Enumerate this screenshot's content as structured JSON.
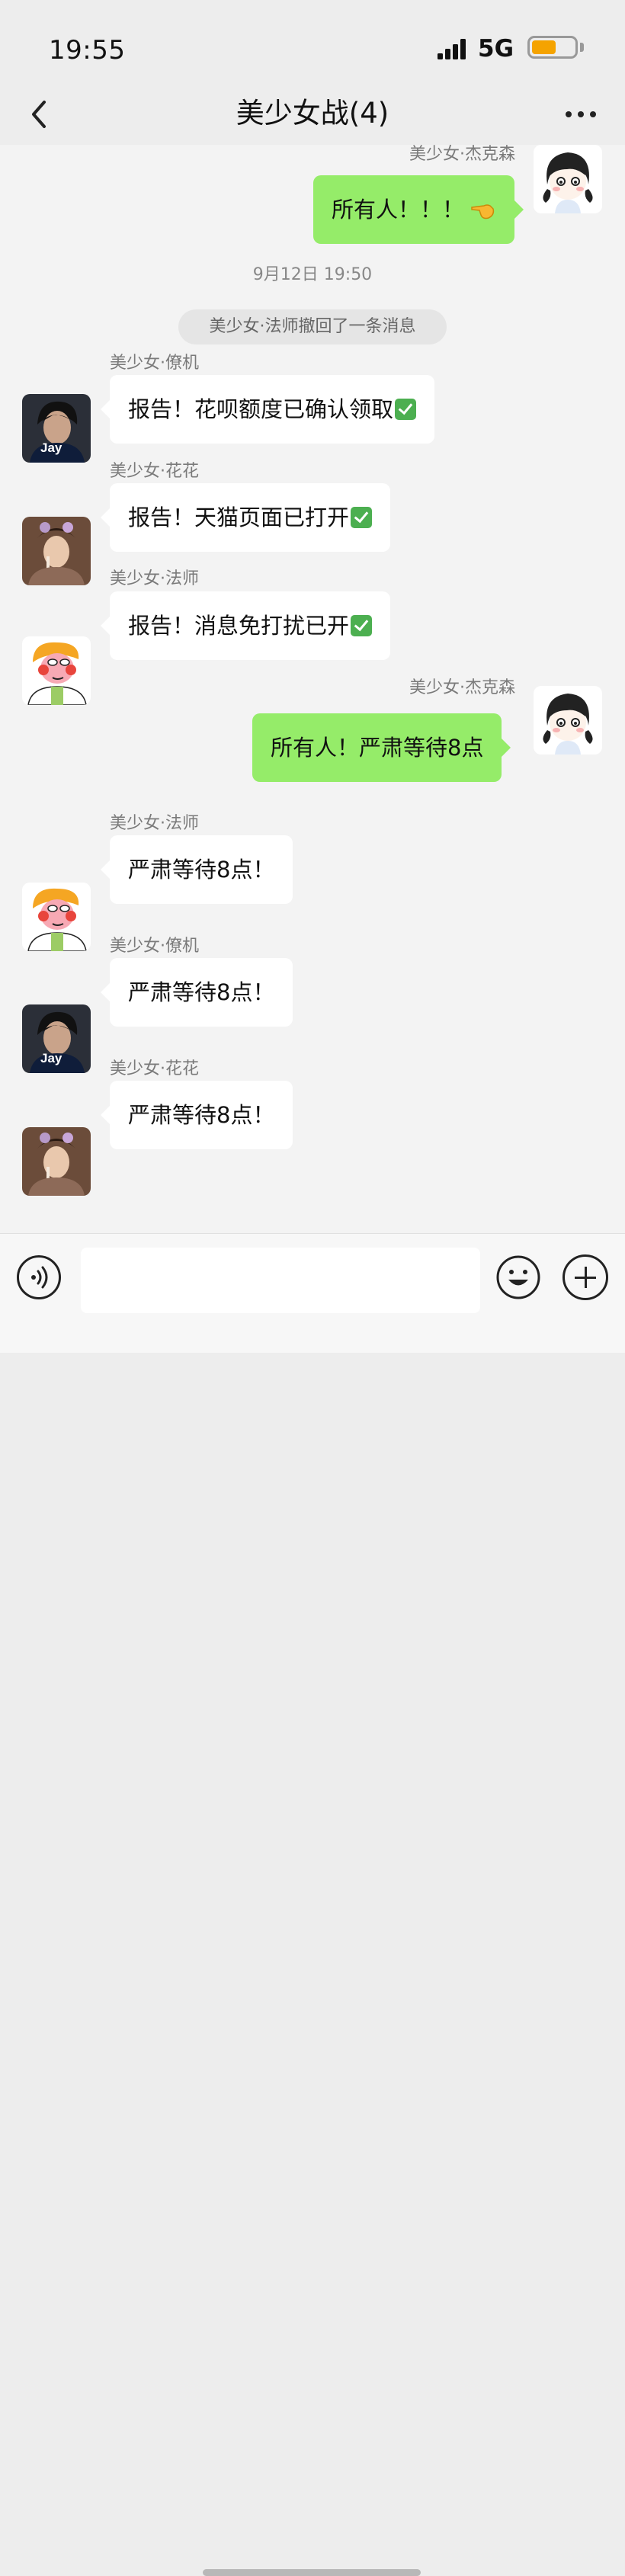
{
  "status_bar": {
    "time": "19:55",
    "network": "5G",
    "battery_level": 0.58,
    "battery_color": "#f5a300"
  },
  "header": {
    "title": "美少女战(4)",
    "back_icon": "chevron-left-icon",
    "more_icon": "more-dots-icon"
  },
  "colors": {
    "bubble_out": "#95ec69",
    "bubble_in": "#ffffff",
    "background": "#f3f3f3"
  },
  "messages": [
    {
      "sender": "美少女·杰克森",
      "text": "所有人！！！",
      "direction": "outgoing",
      "trailing_icon": "pointing-hand-emoji"
    },
    {
      "sender": "美少女·僚机",
      "text": "报告！花呗额度已确认领取",
      "direction": "incoming",
      "trailing_icon": "check-mark-emoji"
    },
    {
      "sender": "美少女·花花",
      "text": "报告！天猫页面已打开",
      "direction": "incoming",
      "trailing_icon": "check-mark-emoji"
    },
    {
      "sender": "美少女·法师",
      "text": "报告！消息免打扰已开",
      "direction": "incoming",
      "trailing_icon": "check-mark-emoji"
    },
    {
      "sender": "美少女·杰克森",
      "text": "所有人！严肃等待8点",
      "direction": "outgoing"
    },
    {
      "sender": "美少女·法师",
      "text": "严肃等待8点！",
      "direction": "incoming"
    },
    {
      "sender": "美少女·僚机",
      "text": "严肃等待8点！",
      "direction": "incoming"
    },
    {
      "sender": "美少女·花花",
      "text": "严肃等待8点！",
      "direction": "incoming"
    }
  ],
  "timestamp": "9月12日 19:50",
  "system_notice": "美少女·法师撤回了一条消息",
  "avatar_text": {
    "liaoji": "Jay"
  },
  "input_bar": {
    "voice_icon": "voice-icon",
    "emoji_icon": "emoji-icon",
    "plus_icon": "plus-icon"
  }
}
